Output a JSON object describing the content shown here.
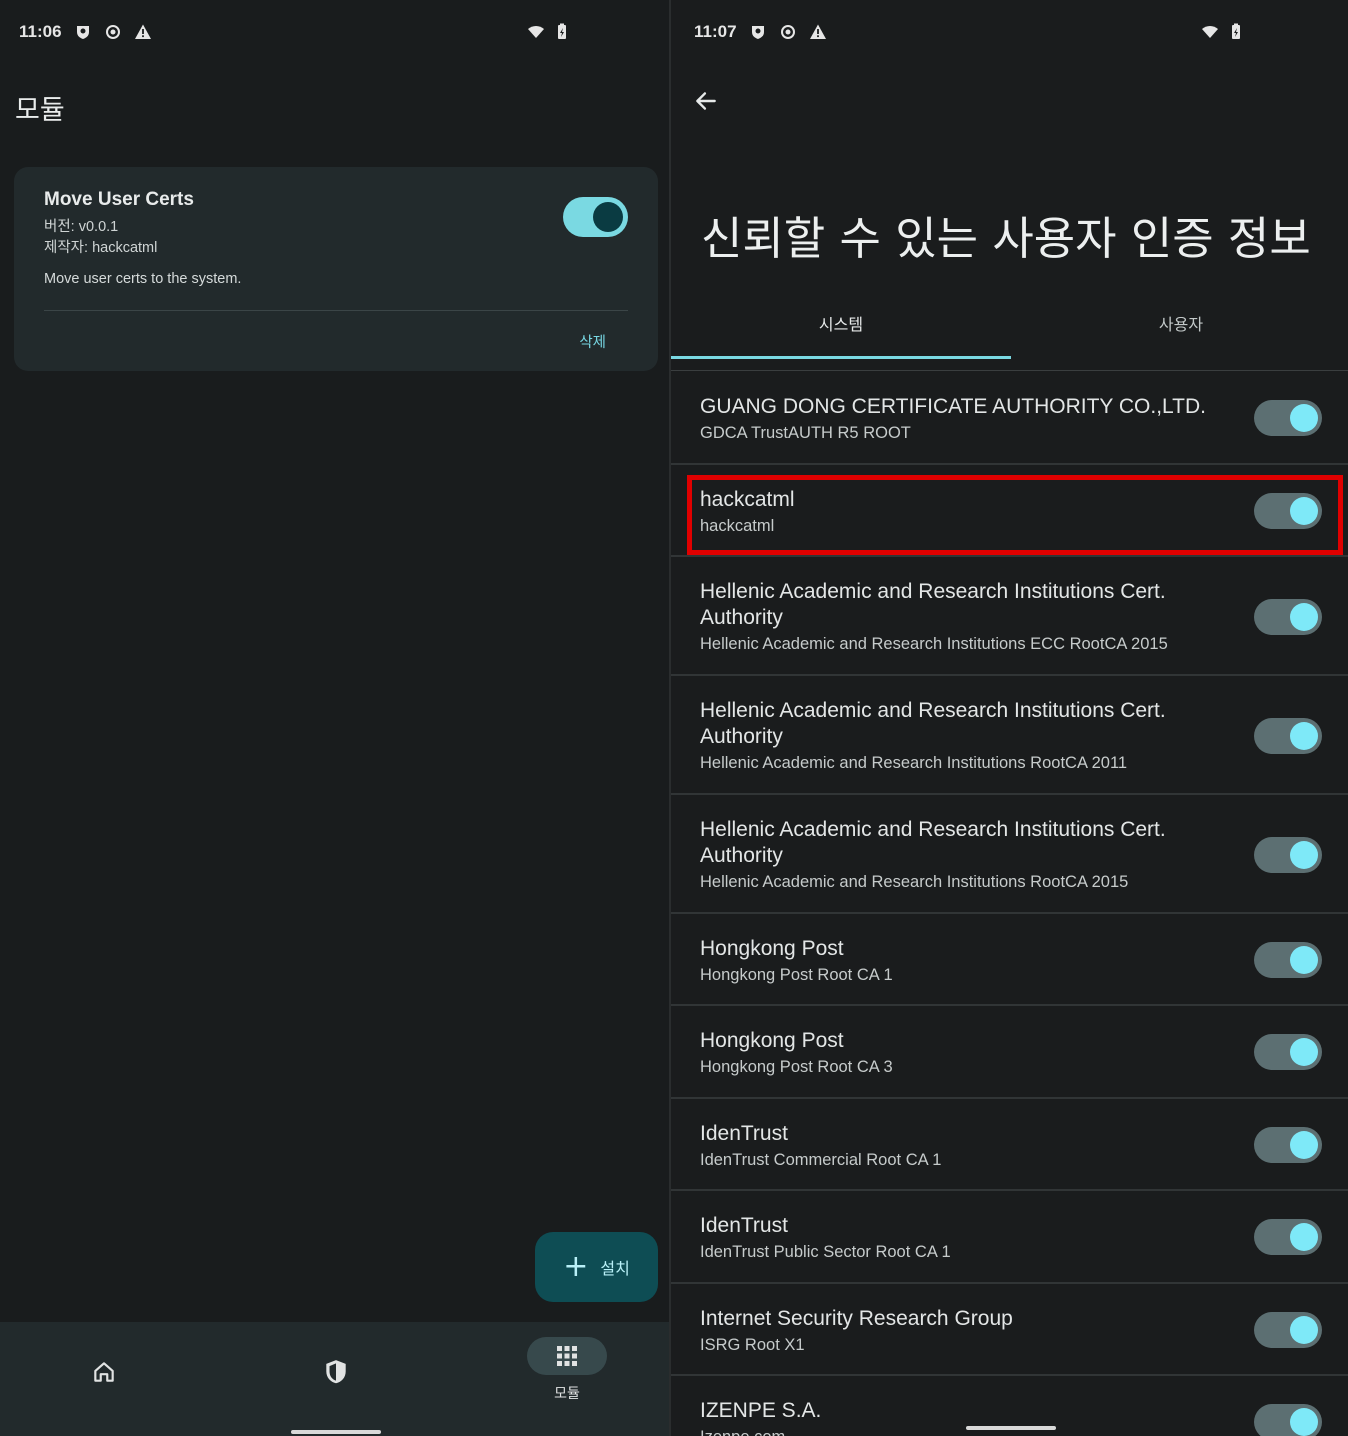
{
  "left": {
    "status": {
      "time": "11:06"
    },
    "title": "모듈",
    "module": {
      "name": "Move User Certs",
      "version": "버전: v0.0.1",
      "author": "제작자: hackcatml",
      "description": "Move user certs to the system.",
      "delete_label": "삭제",
      "enabled": true
    },
    "fab": {
      "plus": "+",
      "label": "설치"
    },
    "nav": {
      "home_icon": "home-icon",
      "shield_icon": "shield-icon",
      "modules_icon": "grid-icon",
      "modules_label": "모듈"
    }
  },
  "right": {
    "status": {
      "time": "11:07"
    },
    "title": "신뢰할 수 있는 사용자 인증 정보",
    "tabs": {
      "system": "시스템",
      "user": "사용자"
    },
    "certs": [
      {
        "title": "GUANG DONG CERTIFICATE AUTHORITY CO.,LTD.",
        "subtitle": "GDCA TrustAUTH R5 ROOT",
        "enabled": true
      },
      {
        "title": "hackcatml",
        "subtitle": "hackcatml",
        "enabled": true,
        "highlighted": true
      },
      {
        "title": "Hellenic Academic and Research Institutions Cert. Authority",
        "subtitle": "Hellenic Academic and Research Institutions ECC RootCA 2015",
        "enabled": true
      },
      {
        "title": "Hellenic Academic and Research Institutions Cert. Authority",
        "subtitle": "Hellenic Academic and Research Institutions RootCA 2011",
        "enabled": true
      },
      {
        "title": "Hellenic Academic and Research Institutions Cert. Authority",
        "subtitle": "Hellenic Academic and Research Institutions RootCA 2015",
        "enabled": true
      },
      {
        "title": "Hongkong Post",
        "subtitle": "Hongkong Post Root CA 1",
        "enabled": true
      },
      {
        "title": "Hongkong Post",
        "subtitle": "Hongkong Post Root CA 3",
        "enabled": true
      },
      {
        "title": "IdenTrust",
        "subtitle": "IdenTrust Commercial Root CA 1",
        "enabled": true
      },
      {
        "title": "IdenTrust",
        "subtitle": "IdenTrust Public Sector Root CA 1",
        "enabled": true
      },
      {
        "title": "Internet Security Research Group",
        "subtitle": "ISRG Root X1",
        "enabled": true
      },
      {
        "title": "IZENPE S.A.",
        "subtitle": "Izenpe.com",
        "enabled": true
      }
    ]
  },
  "colors": {
    "accent": "#7ad9e2",
    "highlight": "#e00000",
    "background": "#191c1d",
    "card": "#222a2c"
  }
}
